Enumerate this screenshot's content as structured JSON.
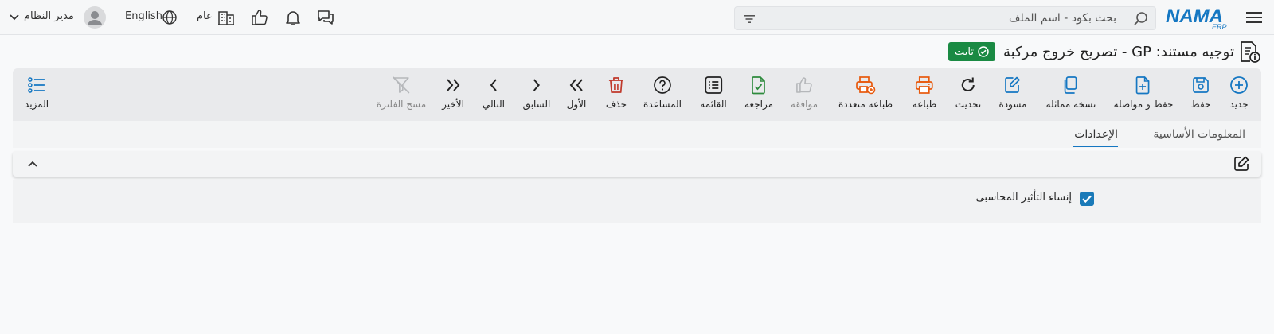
{
  "header": {
    "logo_text": "NAMA",
    "logo_sub": "ERP",
    "search_placeholder": "بحث بكود - اسم الملف",
    "language": "English",
    "company": "عام",
    "user_name": "مدير النظام"
  },
  "document": {
    "title": "توجيه مستند: GP - تصريح خروج مركبة",
    "status": "ثابت"
  },
  "toolbar": {
    "new": "جديد",
    "save": "حفظ",
    "save_continue": "حفظ و مواصلة",
    "duplicate": "نسخة مماثلة",
    "draft": "مسودة",
    "refresh": "تحديث",
    "print": "طباعة",
    "multi_print": "طباعة متعددة",
    "approve": "موافقة",
    "review": "مراجعة",
    "list": "القائمة",
    "help": "المساعدة",
    "delete": "حذف",
    "first": "الأول",
    "previous": "السابق",
    "next": "التالي",
    "last": "الأخير",
    "clear_filter": "مسح الفلترة",
    "more": "المزيد"
  },
  "tabs": {
    "basic_info": "المعلومات الأساسية",
    "settings": "الإعدادات"
  },
  "settings_section": {
    "create_accounting_effect": "إنشاء التأثير المحاسبى",
    "create_accounting_effect_checked": true
  },
  "colors": {
    "accent": "#1577c2",
    "status_green": "#1a8a43",
    "print_orange": "#e8590c",
    "delete_red": "#c0392b",
    "review_green": "#2e8b3d"
  }
}
